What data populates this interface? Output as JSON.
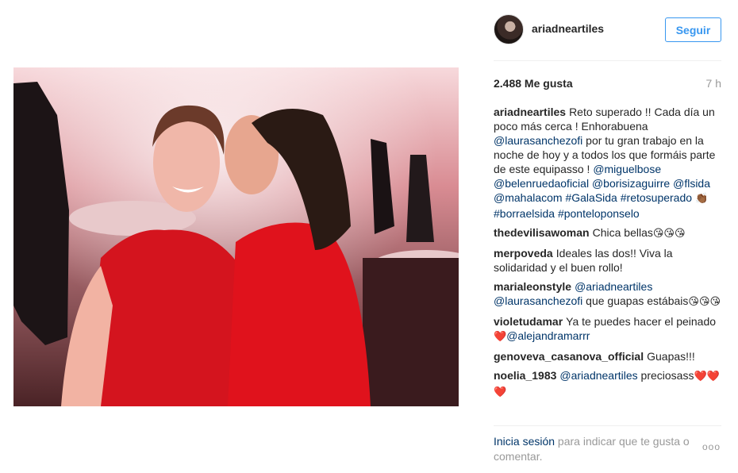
{
  "post": {
    "username": "ariadneartiles",
    "follow_label": "Seguir",
    "likes": "2.488 Me gusta",
    "time_ago": "7 h"
  },
  "caption": {
    "user": "ariadneartiles",
    "text_1": "Reto superado !! Cada día un poco más cerca ! Enhorabuena ",
    "mention_1": "@laurasanchezofi",
    "text_2": " por tu gran trabajo en la noche de hoy y a todos los que formáis parte de este equipasso ! ",
    "mention_2": "@miguelbose",
    "mention_3": "@belenruedaoficial",
    "mention_4": "@borisizaguirre",
    "mention_5": "@flsida",
    "mention_6": "@mahalacom",
    "tag_1": "#GalaSida",
    "tag_2": "#retosuperado",
    "emoji_1": "👏🏾",
    "tag_3": "#borraelsida",
    "tag_4": "#ponteloponselo"
  },
  "comments": [
    {
      "user": "thedevilisawoman",
      "text": "Chica bellas",
      "emoji": "😘😘😘"
    },
    {
      "user": "merpoveda",
      "text": "Ideales las dos!! Viva la solidaridad y el buen rollo!"
    },
    {
      "user": "marialeonstyle",
      "mention_1": "@ariadneartiles",
      "mention_2": "@laurasanchezofi",
      "text": " que guapas estábais",
      "emoji": "😘😘😘"
    },
    {
      "user": "violetudamar",
      "text": "Ya te puedes hacer el peinado ",
      "emoji": "❤️",
      "mention": "@alejandramarrr"
    },
    {
      "user": "genoveva_casanova_official",
      "text": "Guapas!!!"
    },
    {
      "user": "noelia_1983",
      "mention": "@ariadneartiles",
      "text": "preciosass",
      "emoji": "❤️❤️❤️"
    }
  ],
  "footer": {
    "login_link": "Inicia sesión",
    "login_text": " para indicar que te gusta o comentar.",
    "more": "ooo"
  }
}
